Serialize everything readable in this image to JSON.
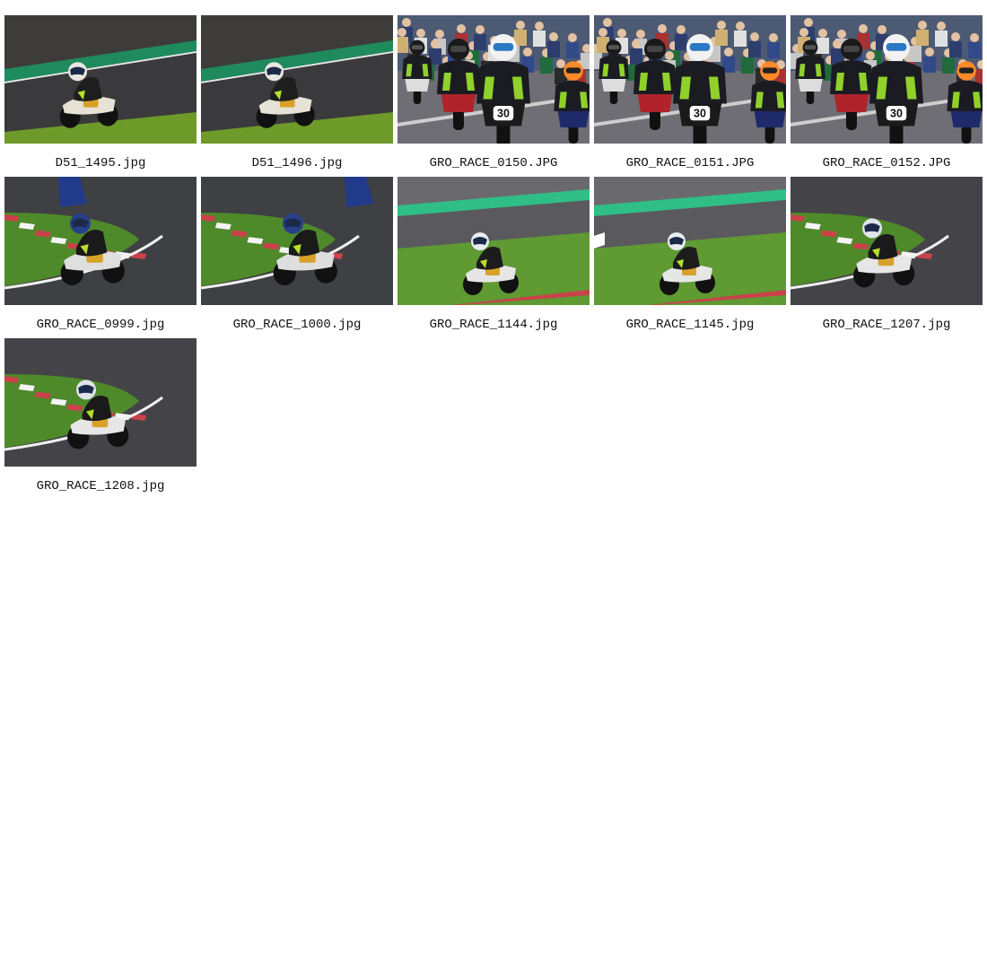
{
  "gallery": {
    "items": [
      {
        "filename": "D51_1495.jpg",
        "scene": "track-lean-right",
        "rider_number": "",
        "colors": {
          "track": "#3a3a3c",
          "grass": "#6e9a2a",
          "stripe": "#1f8a5e"
        }
      },
      {
        "filename": "D51_1496.jpg",
        "scene": "track-lean-right",
        "rider_number": "",
        "colors": {
          "track": "#3a3a3c",
          "grass": "#6e9a2a",
          "stripe": "#1f8a5e"
        }
      },
      {
        "filename": "GRO_RACE_0150.JPG",
        "scene": "pit-crowd",
        "rider_number": "30",
        "colors": {
          "track": "#7a7a80",
          "crowd": "#5b6b8c"
        }
      },
      {
        "filename": "GRO_RACE_0151.JPG",
        "scene": "pit-crowd",
        "rider_number": "30",
        "colors": {
          "track": "#7a7a80",
          "crowd": "#5b6b8c"
        }
      },
      {
        "filename": "GRO_RACE_0152.JPG",
        "scene": "pit-crowd",
        "rider_number": "30",
        "colors": {
          "track": "#7a7a80",
          "crowd": "#5b6b8c"
        }
      },
      {
        "filename": "GRO_RACE_0999.jpg",
        "scene": "curb-corner",
        "rider_number": "",
        "colors": {
          "track": "#3f4044",
          "grass": "#4f8a2a",
          "curb": "#c9424a"
        }
      },
      {
        "filename": "GRO_RACE_1000.jpg",
        "scene": "curb-corner",
        "rider_number": "",
        "colors": {
          "track": "#3f4044",
          "grass": "#4f8a2a",
          "curb": "#c9424a"
        }
      },
      {
        "filename": "GRO_RACE_1144.jpg",
        "scene": "straight-grass",
        "rider_number": "",
        "colors": {
          "track": "#5a5a5e",
          "grass": "#5f9a32",
          "stripe": "#2fbf86"
        }
      },
      {
        "filename": "GRO_RACE_1145.jpg",
        "scene": "straight-grass",
        "rider_number": "",
        "colors": {
          "track": "#5a5a5e",
          "grass": "#5f9a32",
          "stripe": "#2fbf86"
        }
      },
      {
        "filename": "GRO_RACE_1207.jpg",
        "scene": "curb-corner-solo",
        "rider_number": "",
        "colors": {
          "track": "#444448",
          "grass": "#4f8a2a",
          "curb": "#c9424a"
        }
      },
      {
        "filename": "GRO_RACE_1208.jpg",
        "scene": "curb-corner-solo",
        "rider_number": "",
        "colors": {
          "track": "#444448",
          "grass": "#4f8a2a",
          "curb": "#c9424a"
        }
      }
    ]
  }
}
